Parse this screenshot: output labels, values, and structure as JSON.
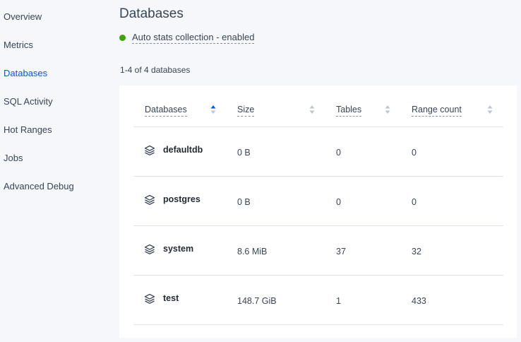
{
  "sidebar": {
    "items": [
      {
        "label": "Overview",
        "active": false
      },
      {
        "label": "Metrics",
        "active": false
      },
      {
        "label": "Databases",
        "active": true
      },
      {
        "label": "SQL Activity",
        "active": false
      },
      {
        "label": "Hot Ranges",
        "active": false
      },
      {
        "label": "Jobs",
        "active": false
      },
      {
        "label": "Advanced Debug",
        "active": false
      }
    ]
  },
  "main": {
    "title": "Databases",
    "stats_status": "Auto stats collection - enabled",
    "result_count": "1-4 of 4 databases"
  },
  "table": {
    "columns": [
      {
        "label": "Databases",
        "sort": "ascending"
      },
      {
        "label": "Size",
        "sort": "none"
      },
      {
        "label": "Tables",
        "sort": "none"
      },
      {
        "label": "Range count",
        "sort": "none"
      }
    ],
    "rows": [
      {
        "name": "defaultdb",
        "size": "0 B",
        "tables": "0",
        "range_count": "0"
      },
      {
        "name": "postgres",
        "size": "0 B",
        "tables": "0",
        "range_count": "0"
      },
      {
        "name": "system",
        "size": "8.6 MiB",
        "tables": "37",
        "range_count": "32"
      },
      {
        "name": "test",
        "size": "148.7 GiB",
        "tables": "1",
        "range_count": "433"
      }
    ]
  },
  "colors": {
    "accent": "#0055ff",
    "status_enabled": "#37a806",
    "sort_inactive": "#c0c6cf"
  },
  "icons": {
    "database": "stack-layers-icon",
    "sort": "sort-arrows-icon",
    "status": "status-dot"
  }
}
